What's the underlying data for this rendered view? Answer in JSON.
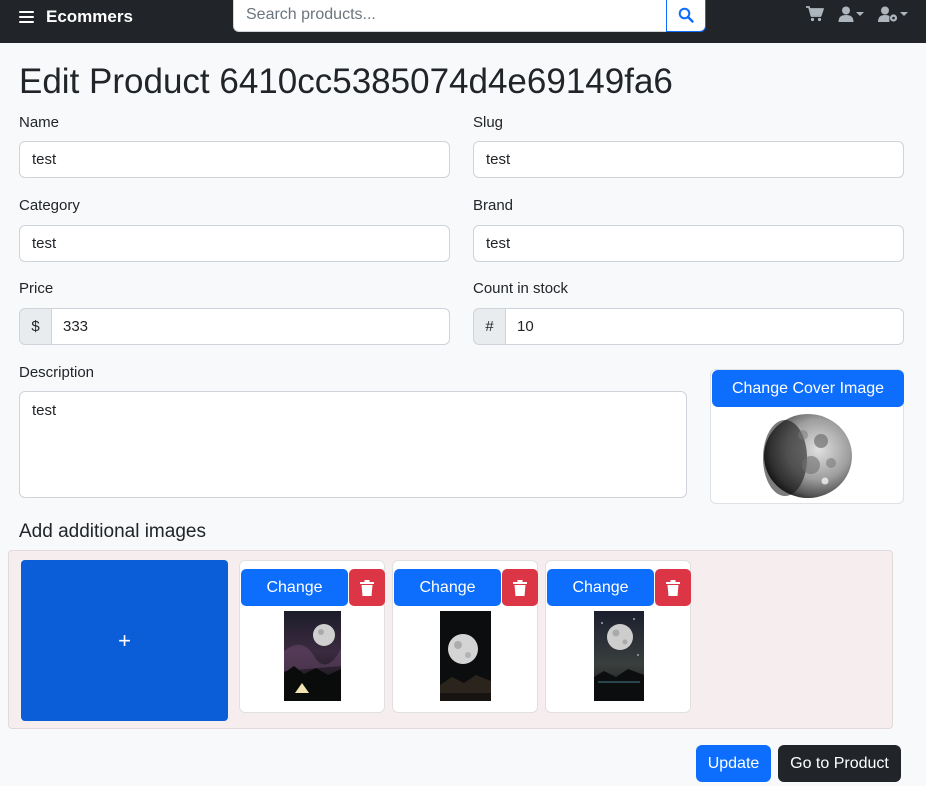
{
  "navbar": {
    "brand": "Ecommers",
    "search": {
      "placeholder": "Search products...",
      "value": ""
    },
    "icons": [
      "cart-icon",
      "user-icon",
      "admin-settings-icon"
    ]
  },
  "page": {
    "title": "Edit Product 6410cc5385074d4e69149fa6"
  },
  "form": {
    "name": {
      "label": "Name",
      "value": "test"
    },
    "slug": {
      "label": "Slug",
      "value": "test"
    },
    "category": {
      "label": "Category",
      "value": "test"
    },
    "brand": {
      "label": "Brand",
      "value": "test"
    },
    "price": {
      "label": "Price",
      "prefix": "$",
      "value": "333"
    },
    "count": {
      "label": "Count in stock",
      "prefix": "#",
      "value": "10"
    },
    "description": {
      "label": "Description",
      "value": "test"
    }
  },
  "cover": {
    "button_label": "Change Cover Image"
  },
  "additional": {
    "heading": "Add additional images",
    "add_label": "+",
    "images": [
      {
        "change_label": "Change"
      },
      {
        "change_label": "Change"
      },
      {
        "change_label": "Change"
      }
    ]
  },
  "actions": {
    "update_label": "Update",
    "goto_label": "Go to Product"
  },
  "colors": {
    "primary": "#0d6efd",
    "danger": "#dc3545",
    "dark": "#212529",
    "add_area_bg": "#f6eeee"
  }
}
